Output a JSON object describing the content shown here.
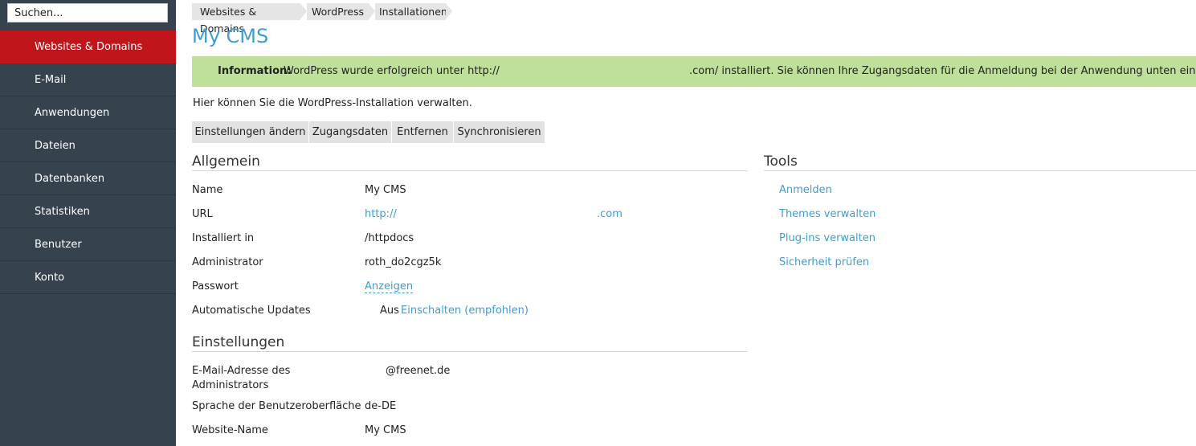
{
  "sidebar": {
    "search_placeholder": "Suchen...",
    "items": [
      {
        "label": "Websites & Domains",
        "active": true
      },
      {
        "label": "E-Mail"
      },
      {
        "label": "Anwendungen"
      },
      {
        "label": "Dateien"
      },
      {
        "label": "Datenbanken"
      },
      {
        "label": "Statistiken"
      },
      {
        "label": "Benutzer"
      },
      {
        "label": "Konto"
      }
    ]
  },
  "breadcrumb": [
    "Websites & Domains",
    "WordPress",
    "Installationen"
  ],
  "page_title": "My CMS",
  "info": {
    "label": "Information:",
    "text_before": "WordPress wurde erfolgreich unter http://",
    "text_after": ".com/ installiert. Sie können Ihre Zugangsdaten für die Anmeldung bei der Anwendung unten einsehen."
  },
  "intro": "Hier können Sie die WordPress-Installation verwalten.",
  "actions": [
    "Einstellungen ändern",
    "Zugangsdaten",
    "Entfernen",
    "Synchronisieren"
  ],
  "general": {
    "title": "Allgemein",
    "name_label": "Name",
    "name_value": "My CMS",
    "url_label": "URL",
    "url_prefix": "http://",
    "url_suffix": ".com",
    "installed_label": "Installiert in",
    "installed_value": "/httpdocs",
    "admin_label": "Administrator",
    "admin_value": "roth_do2cgz5k",
    "password_label": "Passwort",
    "password_link": "Anzeigen",
    "updates_label": "Automatische Updates",
    "updates_value": "Aus",
    "updates_link": "Einschalten (empfohlen)"
  },
  "settings": {
    "title": "Einstellungen",
    "email_label_line1": "E-Mail-Adresse des",
    "email_label_line2": "Administrators",
    "email_value": "@freenet.de",
    "lang_label": "Sprache der Benutzeroberfläche",
    "lang_value": "de-DE",
    "site_label": "Website-Name",
    "site_value": "My CMS"
  },
  "tools": {
    "title": "Tools",
    "links": [
      "Anmelden",
      "Themes verwalten",
      "Plug-ins verwalten",
      "Sicherheit prüfen"
    ]
  },
  "colors": {
    "sidebar_bg": "#37424f",
    "active_item": "#c0161b",
    "accent_link": "#3e9dd1",
    "info_bg": "#bfe09a"
  }
}
